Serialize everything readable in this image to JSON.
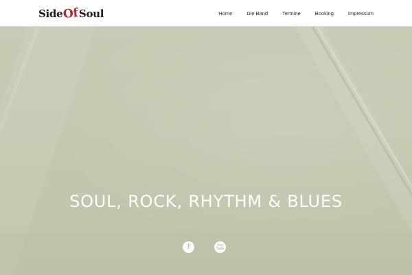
{
  "header": {
    "logo": {
      "part1": "Side",
      "part2": "Of",
      "part3": "Soul"
    },
    "nav": [
      {
        "label": "Home"
      },
      {
        "label": "Die Band"
      },
      {
        "label": "Termine"
      },
      {
        "label": "Booking"
      },
      {
        "label": "Impressum"
      }
    ]
  },
  "hero": {
    "title": "SOUL, ROCK, RHYTHM & BLUES",
    "social": [
      {
        "icon": "facebook-icon",
        "glyph": "f"
      },
      {
        "icon": "youtube-icon",
        "glyph": "You Tube"
      }
    ]
  },
  "colors": {
    "hero_background": "#c4c8b0",
    "logo_accent": "#b3262b",
    "text_light": "#ffffff"
  }
}
